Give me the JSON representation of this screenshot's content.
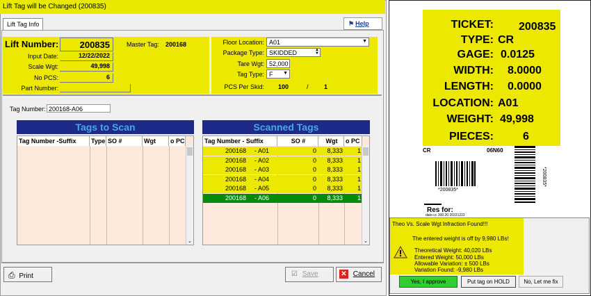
{
  "window": {
    "title": "Lift Tag will be Changed  (200835)",
    "tab": "Lift Tag Info",
    "help_label": "Help"
  },
  "header": {
    "lift_number_label": "Lift Number:",
    "lift_number": "200835",
    "master_tag_label": "Master Tag:",
    "master_tag": "200168",
    "input_date_label": "Input Date:",
    "input_date": "12/22/2022",
    "scale_wgt_label": "Scale Wgt:",
    "scale_wgt": "49,998",
    "no_pcs_label": "No PCS:",
    "no_pcs": "6",
    "part_number_label": "Part Number:",
    "part_number": "",
    "floor_location_label": "Floor Location:",
    "floor_location": "A01",
    "package_type_label": "Package Type:",
    "package_type": "SKIDDED",
    "tare_wgt_label": "Tare Wgt:",
    "tare_wgt": "52,000",
    "tag_type_label": "Tag Type:",
    "tag_type": "F",
    "pcs_per_skid_label": "PCS Per Skid:",
    "pcs_per_skid_a": "100",
    "pcs_per_skid_sep": "/",
    "pcs_per_skid_b": "1"
  },
  "scan": {
    "tag_number_label": "Tag Number:",
    "tag_number_value": "200168-A06"
  },
  "tags_to_scan": {
    "title": "Tags to Scan",
    "columns": [
      "Tag Number -Suffix",
      "Type",
      "SO #",
      "Wgt",
      "o PC"
    ]
  },
  "scanned_tags": {
    "title": "Scanned Tags",
    "columns": [
      "Tag Number  - Suffix",
      "SO #",
      "Wgt",
      "o PC"
    ],
    "rows": [
      {
        "tag": "200168",
        "suffix": "- A01",
        "so": "0",
        "wgt": "8,333",
        "pc": "1"
      },
      {
        "tag": "200168",
        "suffix": "- A02",
        "so": "0",
        "wgt": "8,333",
        "pc": "1"
      },
      {
        "tag": "200168",
        "suffix": "- A03",
        "so": "0",
        "wgt": "8,333",
        "pc": "1"
      },
      {
        "tag": "200168",
        "suffix": "- A04",
        "so": "0",
        "wgt": "8,333",
        "pc": "1"
      },
      {
        "tag": "200168",
        "suffix": "- A05",
        "so": "0",
        "wgt": "8,333",
        "pc": "1"
      },
      {
        "tag": "200168",
        "suffix": "- A06",
        "so": "0",
        "wgt": "8,333",
        "pc": "1"
      }
    ],
    "selected_index": 5
  },
  "footer": {
    "print_label": "Print",
    "save_label": "Save",
    "cancel_label": "Cancel"
  },
  "ticket": {
    "ticket_label": "TICKET:",
    "ticket_value": "200835",
    "type_label": "TYPE:",
    "type_value": "CR",
    "gage_label": "GAGE:",
    "gage_value": "0.0125",
    "width_label": "WIDTH:",
    "width_value": "8.0000",
    "length_label": "LENGTH:",
    "length_value": "0.0000",
    "location_label": "LOCATION:",
    "location_value": "A01",
    "weight_label": "WEIGHT:",
    "weight_value": "49,998",
    "pieces_label": "PIECES:",
    "pieces_value": "6",
    "cr_code": "CR",
    "code_06n60": "06N60",
    "barcode_text": "*200835*",
    "barcode_vertical_text": "*200835*",
    "res_for": "Res for:",
    "small_print": "date-cc 300.20   20221222"
  },
  "dialog": {
    "title": "Theo Vs. Scale Wgt Infraction Found!!!",
    "message": "The entered weight is off by 9,980 LBs!",
    "theoretical": "Theoretical Weight: 40,020 LBs",
    "entered": "Entered Weight: 50,000 LBs",
    "allowable": "Allowable Variation: ± 500 LBs",
    "variation": "Variation Found: -9,980 LBs",
    "approve_label": "Yes, I approve",
    "hold_label": "Put tag on HOLD",
    "no_label": "No, Let me fix"
  },
  "colors": {
    "highlight_yellow": "#ede800",
    "grid_header_navy": "#1e2a8a",
    "grid_header_text": "#4aa8e0",
    "selected_row_green": "#0a8a0a",
    "approve_green": "#33cc33"
  }
}
